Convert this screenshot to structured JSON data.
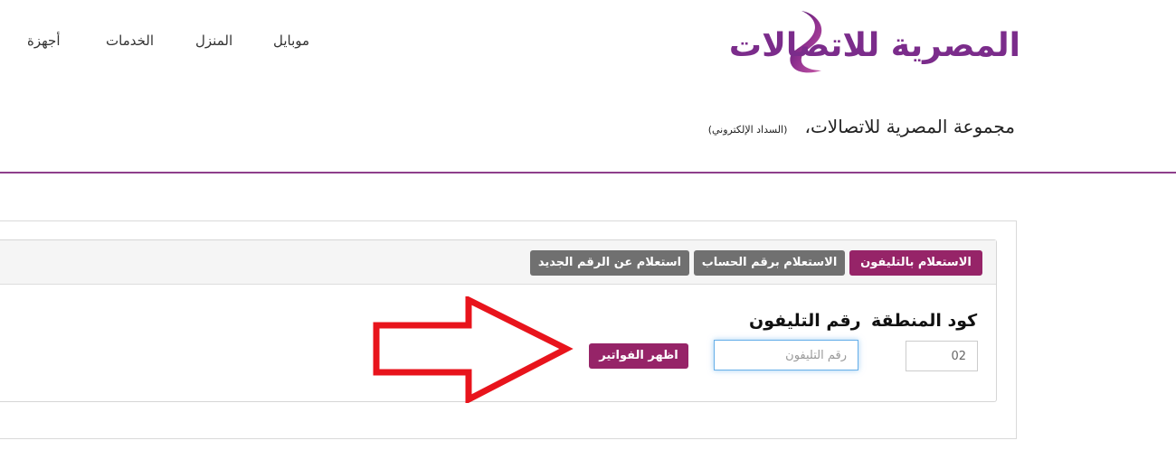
{
  "nav": {
    "items": [
      {
        "label": "موبايل"
      },
      {
        "label": "المنزل"
      },
      {
        "label": "الخدمات"
      },
      {
        "label": "أجهزة"
      }
    ]
  },
  "logo": {
    "text": "المصرية للاتصالات",
    "color": "#7b2c8b"
  },
  "subheader": {
    "title": "مجموعة المصرية للاتصالات،",
    "note": "(السداد الإلكتروني)"
  },
  "tabs": [
    {
      "label": "الاستعلام بالتليفون",
      "active": true
    },
    {
      "label": "الاستعلام برقم الحساب",
      "active": false
    },
    {
      "label": "استعلام عن الرقم الجديد",
      "active": false
    }
  ],
  "form": {
    "area_code_label": "كود المنطقة",
    "area_code_value": "02",
    "phone_label": "رقم التليفون",
    "phone_placeholder": "رقم التليفون",
    "submit_label": "اظهر الفواتير"
  },
  "colors": {
    "accent": "#962468",
    "divider": "#8e3f8c",
    "tab_inactive": "#707070",
    "arrow": "#e8141c"
  }
}
